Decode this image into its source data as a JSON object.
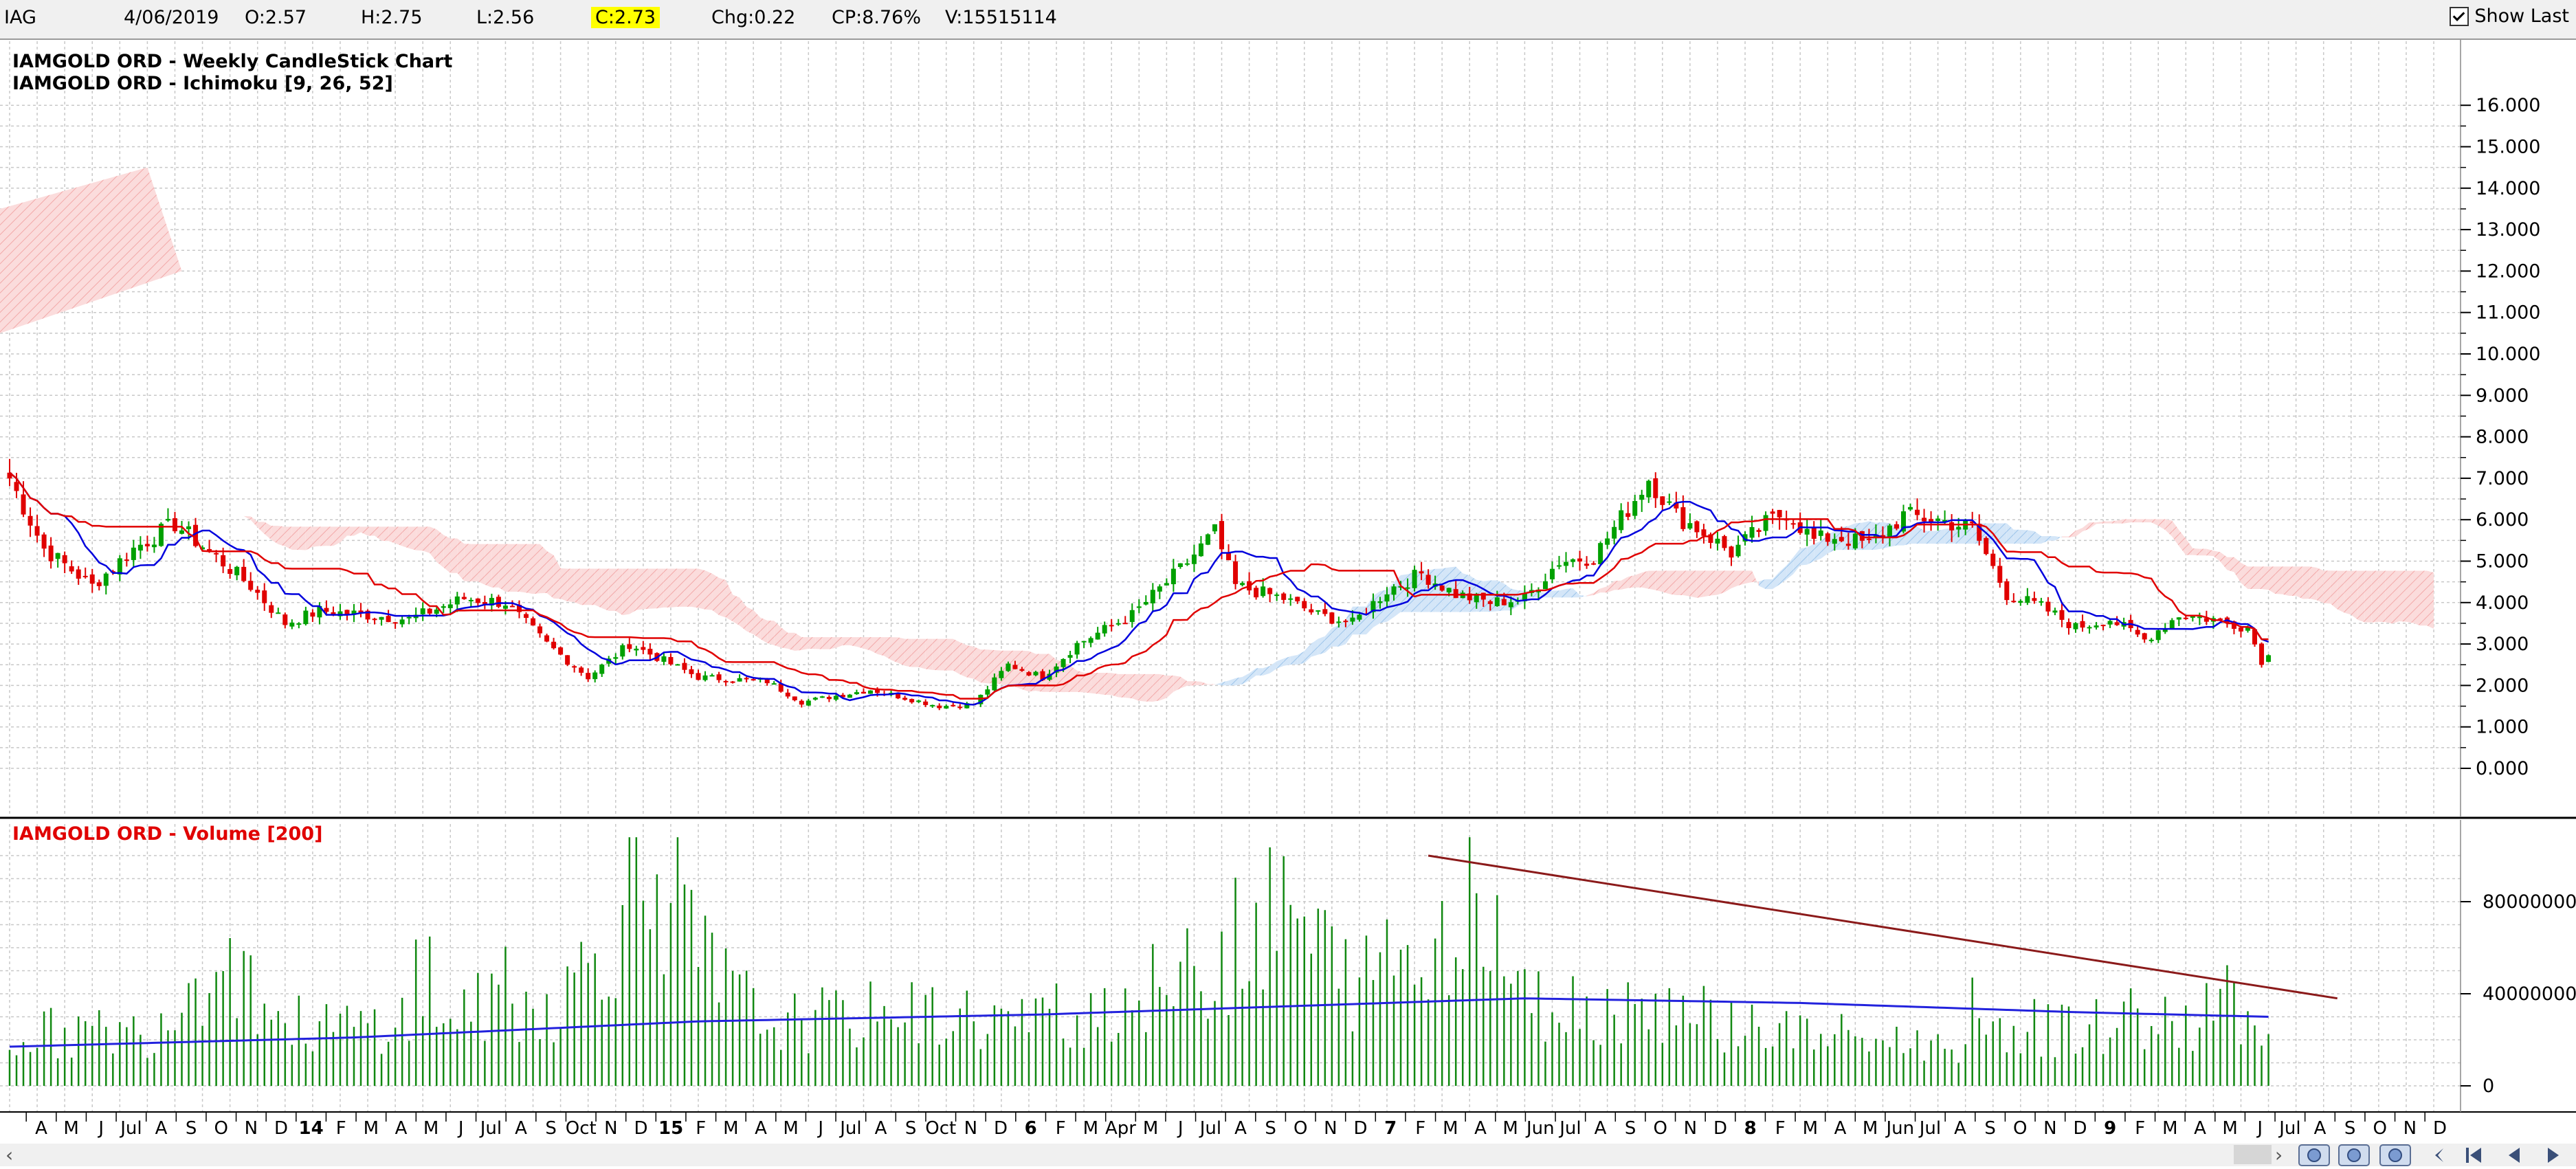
{
  "toolbar": {
    "symbol": "IAG",
    "date": "4/06/2019",
    "open": "O:2.57",
    "high": "H:2.75",
    "low": "L:2.56",
    "close": "C:2.73",
    "change": "Chg:0.22",
    "change_pct": "CP:8.76%",
    "volume": "V:15515114",
    "show_last": "Show Last"
  },
  "price_panel": {
    "title1": "IAMGOLD ORD - Weekly CandleStick Chart",
    "title2": "IAMGOLD ORD - Ichimoku [9, 26, 52]"
  },
  "volume_panel": {
    "title": "IAMGOLD ORD - Volume [200]"
  },
  "colors": {
    "up": "#00a000",
    "down": "#e00000",
    "tenkan": "#0000dd",
    "kijun": "#e00000",
    "cloud_bear": "#f7bcbc",
    "cloud_bull": "#a8cdf0",
    "volume_bar": "#118811",
    "volume_ma": "#2222dd",
    "trendline": "#8b1a1a",
    "highlight": "#ffff00"
  },
  "chart_data": [
    {
      "type": "candlestick",
      "title": "IAMGOLD ORD - Weekly CandleStick Chart",
      "indicator": "Ichimoku [9, 26, 52]",
      "ylim": [
        -1,
        16.5
      ],
      "y_ticks": [
        "16.000",
        "15.000",
        "14.000",
        "13.000",
        "12.000",
        "11.000",
        "10.000",
        "9.000",
        "8.000",
        "7.000",
        "6.000",
        "5.000",
        "4.000",
        "3.000",
        "2.000",
        "1.000",
        "0.000"
      ],
      "x_labels": [
        "A",
        "M",
        "J",
        "Jul",
        "A",
        "S",
        "O",
        "N",
        "D",
        "14",
        "F",
        "M",
        "A",
        "M",
        "J",
        "Jul",
        "A",
        "S",
        "Oct",
        "N",
        "D",
        "15",
        "F",
        "M",
        "A",
        "M",
        "J",
        "Jul",
        "A",
        "S",
        "Oct",
        "N",
        "D",
        "6",
        "F",
        "M",
        "Apr",
        "M",
        "J",
        "Jul",
        "A",
        "S",
        "O",
        "N",
        "D",
        "7",
        "F",
        "M",
        "A",
        "M",
        "Jun",
        "Jul",
        "A",
        "S",
        "O",
        "N",
        "D",
        "8",
        "F",
        "M",
        "A",
        "M",
        "Jun",
        "Jul",
        "A",
        "S",
        "O",
        "N",
        "D",
        "9",
        "F",
        "M",
        "A",
        "M",
        "J",
        "Jul",
        "A",
        "S",
        "O",
        "N",
        "D"
      ],
      "grid": true,
      "close_keypoints": [
        [
          0,
          7.0
        ],
        [
          5,
          5.3
        ],
        [
          12,
          4.4
        ],
        [
          18,
          5.3
        ],
        [
          24,
          5.9
        ],
        [
          30,
          5.1
        ],
        [
          35,
          4.4
        ],
        [
          40,
          3.5
        ],
        [
          45,
          3.8
        ],
        [
          52,
          3.7
        ],
        [
          58,
          3.6
        ],
        [
          66,
          4.1
        ],
        [
          72,
          4.0
        ],
        [
          78,
          3.0
        ],
        [
          84,
          2.2
        ],
        [
          90,
          3.0
        ],
        [
          95,
          2.6
        ],
        [
          100,
          2.2
        ],
        [
          110,
          2.1
        ],
        [
          115,
          1.6
        ],
        [
          125,
          1.9
        ],
        [
          135,
          1.5
        ],
        [
          140,
          1.55
        ],
        [
          145,
          2.5
        ],
        [
          150,
          2.2
        ],
        [
          155,
          3.0
        ],
        [
          163,
          3.7
        ],
        [
          170,
          4.8
        ],
        [
          175,
          5.7
        ],
        [
          178,
          4.4
        ],
        [
          185,
          4.1
        ],
        [
          190,
          3.7
        ],
        [
          195,
          3.5
        ],
        [
          200,
          4.3
        ],
        [
          205,
          4.7
        ],
        [
          210,
          4.2
        ],
        [
          215,
          4.0
        ],
        [
          220,
          4.1
        ],
        [
          225,
          5.0
        ],
        [
          230,
          5.1
        ],
        [
          236,
          6.5
        ],
        [
          238,
          7.0
        ],
        [
          242,
          6.1
        ],
        [
          245,
          5.8
        ],
        [
          250,
          5.2
        ],
        [
          255,
          5.9
        ],
        [
          258,
          6.2
        ],
        [
          262,
          5.5
        ],
        [
          265,
          5.6
        ],
        [
          270,
          5.4
        ],
        [
          275,
          6.1
        ],
        [
          280,
          6.0
        ],
        [
          285,
          5.8
        ],
        [
          290,
          4.2
        ],
        [
          295,
          3.9
        ],
        [
          300,
          3.4
        ],
        [
          305,
          3.6
        ],
        [
          310,
          3.1
        ],
        [
          315,
          3.7
        ],
        [
          320,
          3.6
        ],
        [
          325,
          3.4
        ],
        [
          327,
          2.6
        ],
        [
          328,
          2.73
        ]
      ]
    },
    {
      "type": "bar",
      "title": "IAMGOLD ORD - Volume [200]",
      "ylim": [
        -10000000,
        100000000
      ],
      "y_ticks": [
        "80000000",
        "40000000",
        "0"
      ],
      "ma_period": 200,
      "volume_keypoints": [
        [
          0,
          25000000
        ],
        [
          20,
          26000000
        ],
        [
          30,
          65000000
        ],
        [
          40,
          30000000
        ],
        [
          50,
          28000000
        ],
        [
          60,
          35000000
        ],
        [
          80,
          40000000
        ],
        [
          94,
          110000000
        ],
        [
          100,
          60000000
        ],
        [
          110,
          30000000
        ],
        [
          130,
          35000000
        ],
        [
          150,
          30000000
        ],
        [
          170,
          50000000
        ],
        [
          180,
          70000000
        ],
        [
          185,
          85000000
        ],
        [
          195,
          50000000
        ],
        [
          205,
          55000000
        ],
        [
          210,
          95000000
        ],
        [
          220,
          40000000
        ],
        [
          240,
          38000000
        ],
        [
          260,
          25000000
        ],
        [
          280,
          20000000
        ],
        [
          300,
          28000000
        ],
        [
          318,
          30000000
        ],
        [
          322,
          45000000
        ],
        [
          328,
          20000000
        ]
      ],
      "ma_keypoints": [
        [
          0,
          17000000
        ],
        [
          50,
          21000000
        ],
        [
          100,
          28000000
        ],
        [
          150,
          31000000
        ],
        [
          200,
          36000000
        ],
        [
          220,
          38000000
        ],
        [
          260,
          36000000
        ],
        [
          300,
          32000000
        ],
        [
          328,
          30000000
        ]
      ],
      "trendline": {
        "from": [
          206,
          100000000
        ],
        "to": [
          338,
          38000000
        ]
      }
    }
  ]
}
